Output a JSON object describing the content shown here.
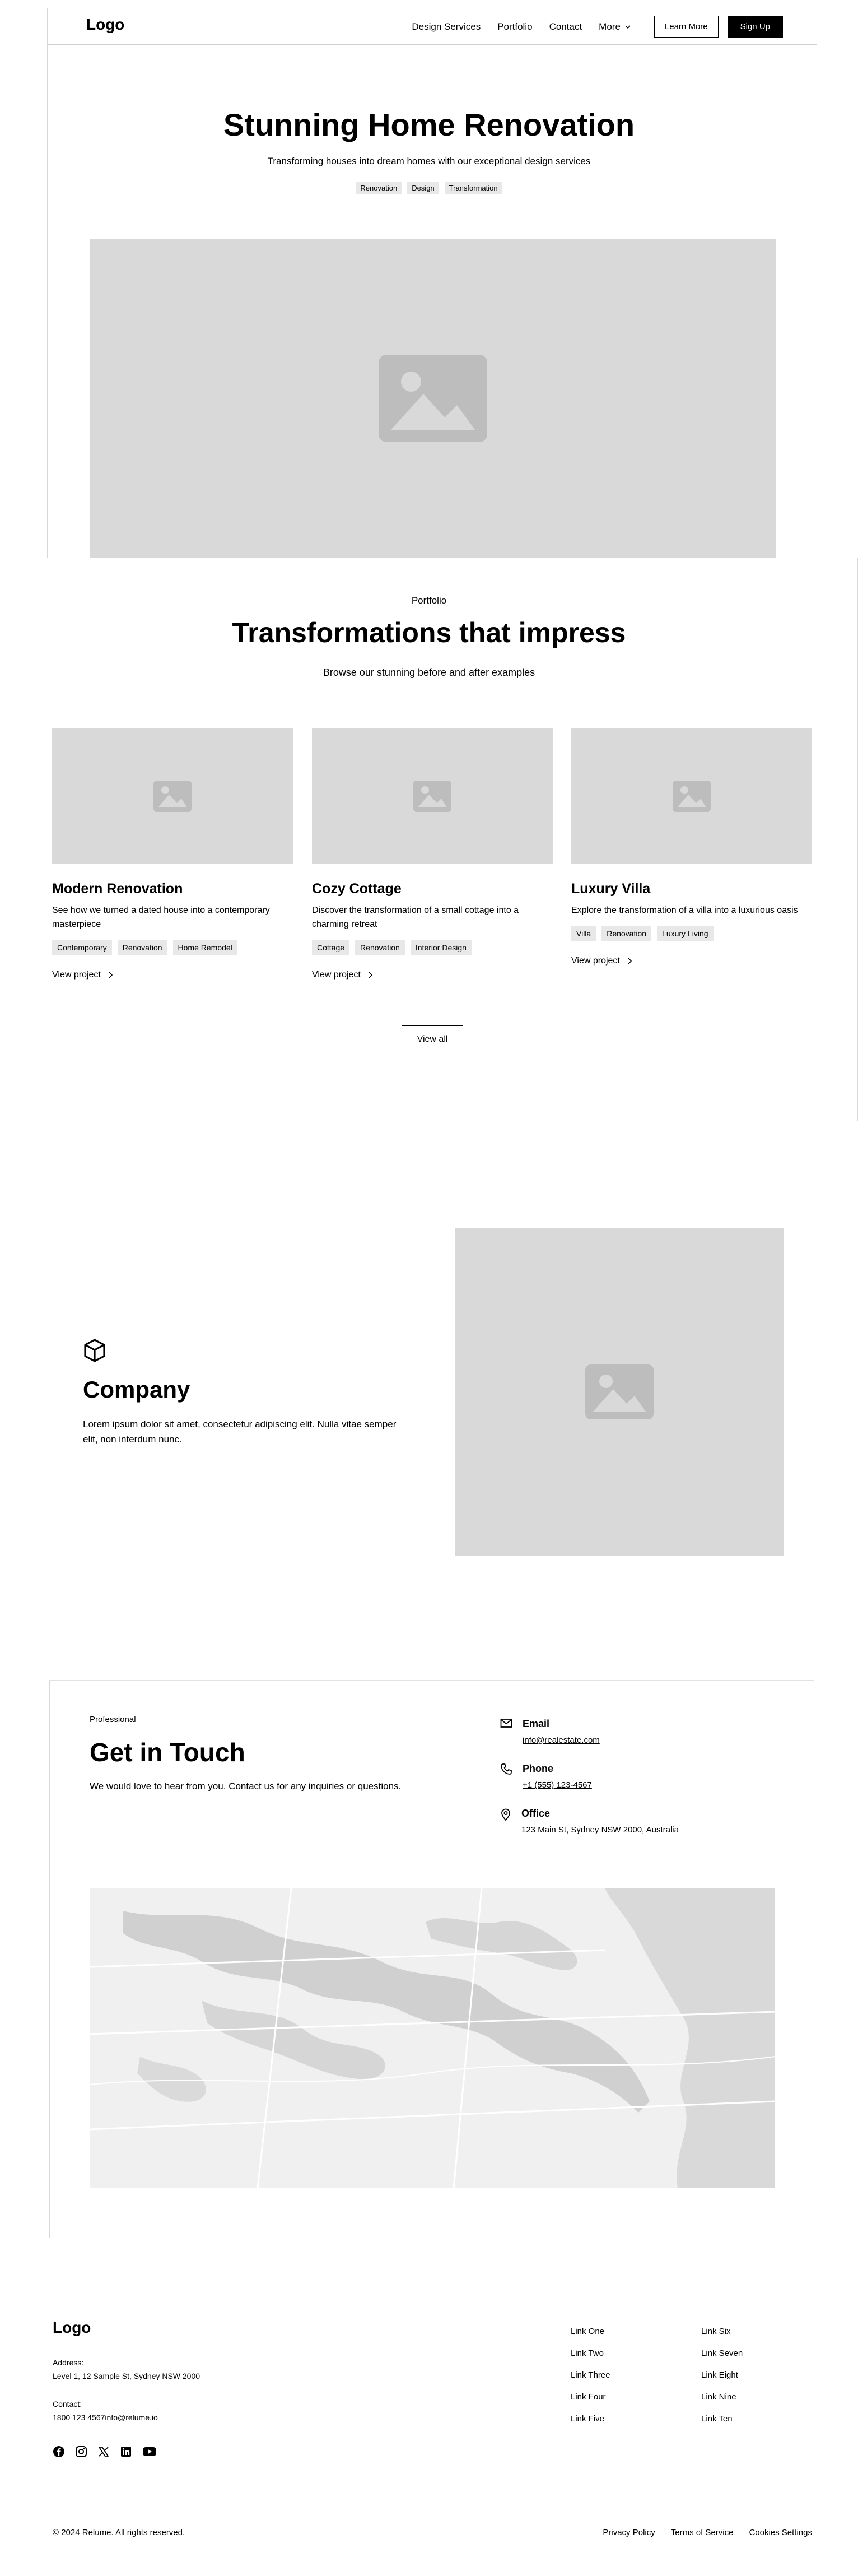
{
  "nav": {
    "logo": "Logo",
    "links": [
      "Design Services",
      "Portfolio",
      "Contact"
    ],
    "more_label": "More",
    "learn_more": "Learn More",
    "sign_up": "Sign Up"
  },
  "hero": {
    "title": "Stunning Home Renovation",
    "subtitle": "Transforming houses into dream homes with our exceptional design services",
    "tags": [
      "Renovation",
      "Design",
      "Transformation"
    ],
    "image_icon": "image-placeholder-icon"
  },
  "portfolio": {
    "eyebrow": "Portfolio",
    "title": "Transformations that impress",
    "subtitle": "Browse our stunning before and after examples",
    "projects": [
      {
        "title": "Modern Renovation",
        "description": "See how we turned a dated house into a contemporary masterpiece",
        "tags": [
          "Contemporary",
          "Renovation",
          "Home Remodel"
        ],
        "link": "View project"
      },
      {
        "title": "Cozy Cottage",
        "description": "Discover the transformation of a small cottage into a charming retreat",
        "tags": [
          "Cottage",
          "Renovation",
          "Interior Design"
        ],
        "link": "View project"
      },
      {
        "title": "Luxury Villa",
        "description": "Explore the transformation of a villa into a luxurious oasis",
        "tags": [
          "Villa",
          "Renovation",
          "Luxury Living"
        ],
        "link": "View project"
      }
    ],
    "view_all": "View all"
  },
  "company": {
    "icon": "cube-icon",
    "title": "Company",
    "description": "Lorem ipsum dolor sit amet, consectetur adipiscing elit. Nulla vitae semper elit, non interdum nunc."
  },
  "contact": {
    "eyebrow": "Professional",
    "title": "Get in Touch",
    "description": "We would love to hear from you. Contact us for any inquiries or questions.",
    "email": {
      "label": "Email",
      "value": "info@realestate.com",
      "icon": "mail-icon"
    },
    "phone": {
      "label": "Phone",
      "value": "+1 (555) 123-4567",
      "icon": "phone-icon"
    },
    "office": {
      "label": "Office",
      "value": "123 Main St, Sydney NSW 2000, Australia",
      "icon": "map-pin-icon"
    }
  },
  "footer": {
    "logo": "Logo",
    "address_label": "Address:",
    "address": "Level 1, 12 Sample St, Sydney NSW 2000",
    "contact_label": "Contact:",
    "contact": "1800 123 4567info@relume.io",
    "social_icons": [
      "facebook-icon",
      "instagram-icon",
      "x-icon",
      "linkedin-icon",
      "youtube-icon"
    ],
    "links_col1": [
      "Link One",
      "Link Two",
      "Link Three",
      "Link Four",
      "Link Five"
    ],
    "links_col2": [
      "Link Six",
      "Link Seven",
      "Link Eight",
      "Link Nine",
      "Link Ten"
    ],
    "copyright": "© 2024 Relume. All rights reserved.",
    "legal": [
      "Privacy Policy",
      "Terms of Service",
      "Cookies Settings"
    ]
  }
}
